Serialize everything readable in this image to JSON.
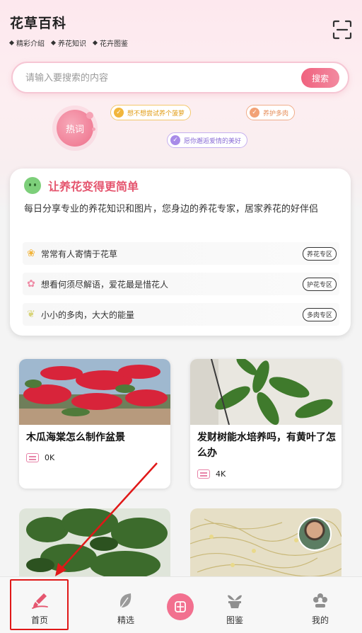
{
  "header": {
    "title": "花草百科",
    "subnav": [
      "精彩介绍",
      "养花知识",
      "花卉图鉴"
    ]
  },
  "search": {
    "placeholder": "请输入要搜索的内容",
    "button_label": "搜索"
  },
  "hot": {
    "label": "热词",
    "tags": [
      "想不想尝试养个菠萝",
      "养护多肉",
      "愿你邂逅爱情的美好"
    ]
  },
  "intro": {
    "title": "让养花变得更简单",
    "description": "每日分享专业的养花知识和图片，您身边的养花专家，居家养花的好伴侣",
    "rows": [
      {
        "text": "常常有人寄情于花草",
        "zone": "养花专区"
      },
      {
        "text": "想看何须尽解语，爱花最是惜花人",
        "zone": "护花专区"
      },
      {
        "text": "小小的多肉，大大的能量",
        "zone": "多肉专区"
      }
    ]
  },
  "articles": [
    {
      "title": "木瓜海棠怎么制作盆景",
      "views": "0K"
    },
    {
      "title": "发财树能水培养吗，有黄叶了怎么办",
      "views": "4K"
    }
  ],
  "tabbar": {
    "items": [
      "首页",
      "精选",
      "图鉴",
      "我的"
    ],
    "active_color": "#e5566f"
  },
  "colors": {
    "accent": "#f0627e",
    "highlight_box": "#e01818"
  }
}
